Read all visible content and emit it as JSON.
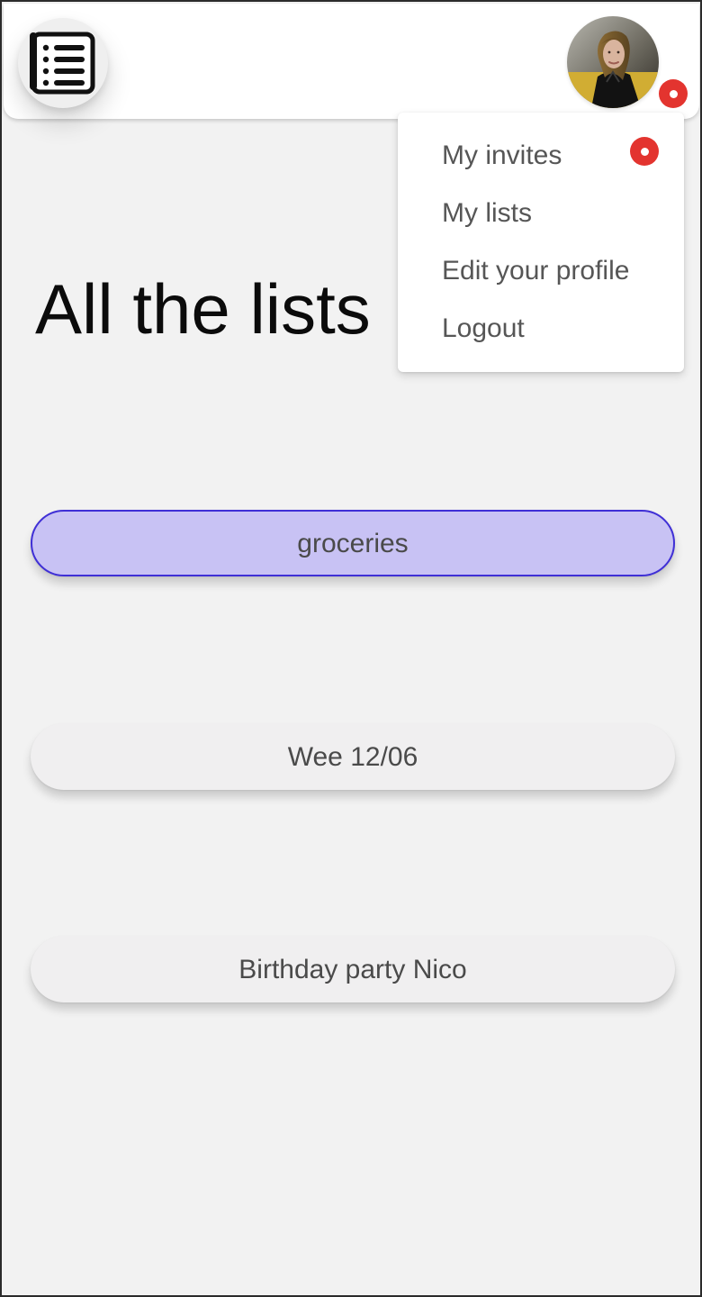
{
  "header": {
    "menu_icon": "hamburger-list-icon",
    "avatar_icon": "user-avatar-photo",
    "avatar_notification": "notification-dot-icon"
  },
  "dropdown": {
    "items": [
      {
        "label": "My invites",
        "badge": "notification-dot-icon"
      },
      {
        "label": "My lists"
      },
      {
        "label": "Edit your profile"
      },
      {
        "label": "Logout"
      }
    ]
  },
  "main": {
    "title": "All the lists",
    "lists": [
      {
        "label": "groceries",
        "selected": true
      },
      {
        "label": "Wee 12/06",
        "selected": false
      },
      {
        "label": "Birthday party Nico",
        "selected": false
      }
    ]
  },
  "colors": {
    "background": "#f2f2f2",
    "header_background": "#ffffff",
    "active_list_fill": "#c8c2f4",
    "active_list_border": "#3f2fd6",
    "inactive_list_fill": "#f0eff0",
    "notification": "#e3342f",
    "menu_text": "#565656",
    "title_text": "#0b0b0b"
  }
}
